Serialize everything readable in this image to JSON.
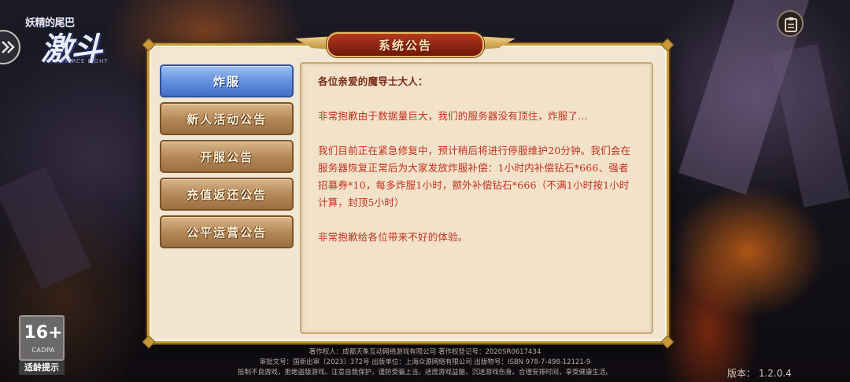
{
  "game": {
    "logo_top": "妖精的尾巴",
    "logo_main": "激斗",
    "logo_sub": "FIERCE FIGHT"
  },
  "dialog": {
    "title": "系统公告"
  },
  "tabs": [
    {
      "label": "炸服",
      "active": true
    },
    {
      "label": "新人活动公告",
      "active": false
    },
    {
      "label": "开服公告",
      "active": false
    },
    {
      "label": "充值返还公告",
      "active": false
    },
    {
      "label": "公平运营公告",
      "active": false
    }
  ],
  "notice": {
    "greeting": "各位亲爱的魔导士大人：",
    "paragraphs": [
      "非常抱歉由于数据量巨大，我们的服务器没有顶住，炸服了...",
      "我们目前正在紧急修复中，预计稍后将进行停服维护20分钟。我们会在服务器恢复正常后为大家发放炸服补偿：1小时内补偿钻石*666、强者招募券*10，每多炸服1小时，额外补偿钻石*666（不满1小时按1小时计算，封顶5小时）",
      "非常抱歉给各位带来不好的体验。"
    ]
  },
  "age_rating": {
    "age": "16+",
    "org": "CADPA",
    "tip": "适龄提示"
  },
  "footer": {
    "line1": "著作权人：成都天象互动网络游戏有限公司    著作权登记号：2020SR0617434",
    "line2": "审批文号：国新出审〔2023〕372号    出版单位：上海众源网络有限公司    出版物号：ISBN 978-7-498-12121-9",
    "line3": "抵制不良游戏，拒绝盗版游戏。注意自我保护，谨防受骗上当。适度游戏益脑，沉迷游戏伤身。合理安排时间，享受健康生活。",
    "version": "版本： 1.2.0.4"
  },
  "colors": {
    "notice_text": "#c1311f",
    "tab_active": "#6592e0",
    "tab_normal": "#b38655",
    "title_plate": "#8e2414",
    "frame_gold": "#c99838"
  },
  "icons": {
    "back": "double-chevron-right-icon",
    "notice": "clipboard-icon"
  }
}
